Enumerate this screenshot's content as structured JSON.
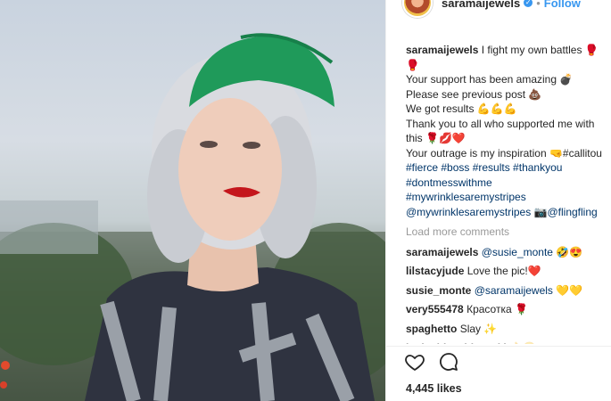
{
  "post": {
    "username": "saramaijewels",
    "follow_label": "Follow",
    "dot": "•",
    "verified_glyph": "✓"
  },
  "caption": {
    "username": "saramaijewels",
    "lines": [
      "I fight my own battles 🥊",
      "🥊",
      "Your support has been amazing 💣",
      "Please see previous post 💩",
      "We got results 💪💪💪",
      "Thank you to all who supported me with",
      "this 🌹💋❤️",
      "Your outrage is my inspiration 🤜#callitou",
      "#fierce #boss #results #thankyou",
      "#dontmesswithme",
      "#mywrinklesaremystripes",
      "@mywrinklesaremystripes 📷@flingfling"
    ]
  },
  "load_more": "Load more comments",
  "comments": [
    {
      "user": "saramaijewels",
      "text": "@susie_monte 🤣😍"
    },
    {
      "user": "lilstacyjude",
      "text": "Love the pic!❤️"
    },
    {
      "user": "susie_monte",
      "text": "@saramaijewels 💛💛"
    },
    {
      "user": "very555478",
      "text": "Красотка 🌹"
    },
    {
      "user": "spaghetto",
      "text": "Slay ✨"
    },
    {
      "user": "janineblaschkowski",
      "text": "👌😍"
    }
  ],
  "likes": "4,445 likes",
  "icons": {
    "like": "heart-icon",
    "comment": "comment-icon"
  },
  "colors": {
    "link": "#3897f0",
    "hashtag": "#003569",
    "cap": "#1f9a5a",
    "lips": "#c4161c"
  }
}
